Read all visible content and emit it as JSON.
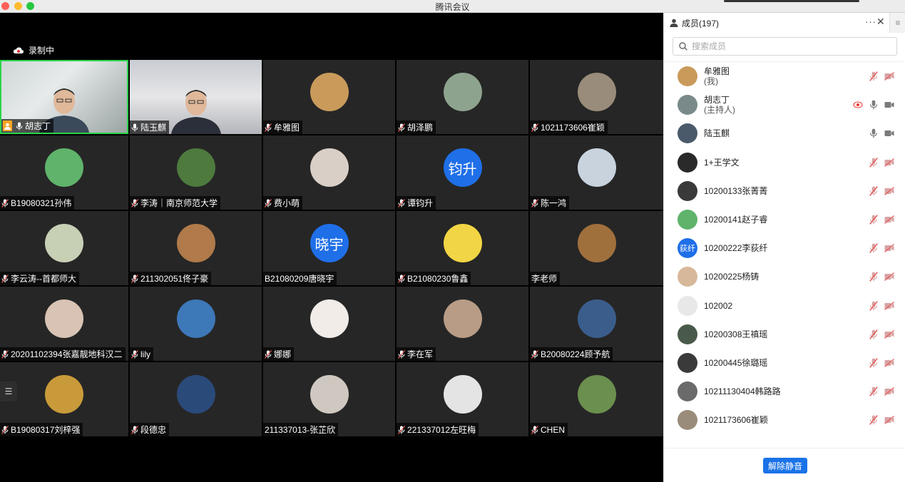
{
  "window": {
    "title": "腾讯会议"
  },
  "recording": {
    "label": "录制中"
  },
  "grid": {
    "tiles": [
      {
        "name": "胡志丁",
        "kind": "video1",
        "mic": "on",
        "host": true
      },
      {
        "name": "陆玉麒",
        "kind": "video2",
        "mic": "on"
      },
      {
        "name": "牟雅图",
        "kind": "avatar",
        "mic": "muted",
        "avatar_color": "#c99a5a"
      },
      {
        "name": "胡泽鹏",
        "kind": "avatar",
        "mic": "muted",
        "avatar_color": "#8ea38e"
      },
      {
        "name": "1021173606崔颖",
        "kind": "avatar",
        "mic": "muted",
        "avatar_color": "#9a8c7a"
      },
      {
        "name": "B19080321孙伟",
        "kind": "avatar",
        "mic": "muted",
        "avatar_color": "#5fb36b"
      },
      {
        "name": "李涛｜南京师范大学",
        "kind": "avatar",
        "mic": "muted",
        "avatar_color": "#4e7a3e"
      },
      {
        "name": "费小萌",
        "kind": "avatar",
        "mic": "muted",
        "avatar_color": "#d9cfc6"
      },
      {
        "name": "谭钧升",
        "kind": "text",
        "mic": "muted",
        "avatar_color": "#1f6fe8",
        "avatar_text": "钧升"
      },
      {
        "name": "陈一鸿",
        "kind": "avatar",
        "mic": "muted",
        "avatar_color": "#c8d3de"
      },
      {
        "name": "李云涛--首都师大",
        "kind": "avatar",
        "mic": "muted",
        "avatar_color": "#c7cfb5"
      },
      {
        "name": "211302051佟子豪",
        "kind": "avatar",
        "mic": "muted",
        "avatar_color": "#b07a4a"
      },
      {
        "name": "B21080209唐晓宇",
        "kind": "text",
        "mic": "none",
        "avatar_color": "#1f6fe8",
        "avatar_text": "晓宇"
      },
      {
        "name": "B21080230鲁鑫",
        "kind": "avatar",
        "mic": "muted",
        "avatar_color": "#f2d544"
      },
      {
        "name": "李老师",
        "kind": "avatar",
        "mic": "none",
        "avatar_color": "#a0703c"
      },
      {
        "name": "20201102394张嘉靓地科汉二",
        "kind": "avatar",
        "mic": "muted",
        "avatar_color": "#d8c3b4"
      },
      {
        "name": "lily",
        "kind": "avatar",
        "mic": "muted",
        "avatar_color": "#3d78b8"
      },
      {
        "name": "娜娜",
        "kind": "avatar",
        "mic": "muted",
        "avatar_color": "#f1ece8"
      },
      {
        "name": "李在军",
        "kind": "avatar",
        "mic": "muted",
        "avatar_color": "#b89c86"
      },
      {
        "name": "B20080224顾予航",
        "kind": "avatar",
        "mic": "muted",
        "avatar_color": "#3a5d8c"
      },
      {
        "name": "B19080317刘梓强",
        "kind": "avatar",
        "mic": "muted",
        "avatar_color": "#c89a3a"
      },
      {
        "name": "段德忠",
        "kind": "avatar",
        "mic": "muted",
        "avatar_color": "#2a4a7a"
      },
      {
        "name": "211337013-张芷欣",
        "kind": "avatar",
        "mic": "none",
        "avatar_color": "#cfc8c0"
      },
      {
        "name": "221337012左旺梅",
        "kind": "avatar",
        "mic": "muted",
        "avatar_color": "#e4e4e4"
      },
      {
        "name": "CHEN",
        "kind": "avatar",
        "mic": "muted",
        "avatar_color": "#6b8f4e"
      }
    ]
  },
  "panel": {
    "title": "成员(197)",
    "more_icon": "···",
    "close_icon": "✕",
    "menu_icon": "≡",
    "search_placeholder": "搜索成员",
    "unmute_all_label": "解除静音",
    "members": [
      {
        "name": "牟雅图",
        "sub": "(我)",
        "mic": "muted",
        "cam": "off",
        "avatar_color": "#c99a5a"
      },
      {
        "name": "胡志丁",
        "sub": "(主持人)",
        "mic": "on",
        "cam": "on",
        "rec": true,
        "avatar_color": "#7a8a8a"
      },
      {
        "name": "陆玉麒",
        "sub": "",
        "mic": "on",
        "cam": "on",
        "avatar_color": "#4a5a6a"
      },
      {
        "name": "1+王学文",
        "sub": "",
        "mic": "muted",
        "cam": "off",
        "avatar_color": "#2a2a2a"
      },
      {
        "name": "10200133张菁菁",
        "sub": "",
        "mic": "muted",
        "cam": "off",
        "avatar_color": "#3a3a3a"
      },
      {
        "name": "10200141赵子睿",
        "sub": "",
        "mic": "muted",
        "cam": "off",
        "avatar_color": "#5fb36b"
      },
      {
        "name": "10200222李荻纤",
        "sub": "",
        "mic": "muted",
        "cam": "off",
        "avatar_color": "#1f6fe8",
        "avatar_text": "荻纤"
      },
      {
        "name": "10200225杨铸",
        "sub": "",
        "mic": "muted",
        "cam": "off",
        "avatar_color": "#d8b89a"
      },
      {
        "name": "102002",
        "sub": "",
        "mic": "muted",
        "cam": "off",
        "avatar_color": "#e8e8e8"
      },
      {
        "name": "10200308王禛瑶",
        "sub": "",
        "mic": "muted",
        "cam": "off",
        "avatar_color": "#4a5a4a"
      },
      {
        "name": "10200445徐璐瑶",
        "sub": "",
        "mic": "muted",
        "cam": "off",
        "avatar_color": "#3a3a3a"
      },
      {
        "name": "10211130404韩路路",
        "sub": "",
        "mic": "muted",
        "cam": "off",
        "avatar_color": "#6a6a6a"
      },
      {
        "name": "1021173606崔颖",
        "sub": "",
        "mic": "muted",
        "cam": "off",
        "avatar_color": "#9a8c7a"
      }
    ]
  },
  "colors": {
    "accent": "#1a73e8",
    "active_speaker": "#2bd44a",
    "muted": "#e35d5d"
  }
}
